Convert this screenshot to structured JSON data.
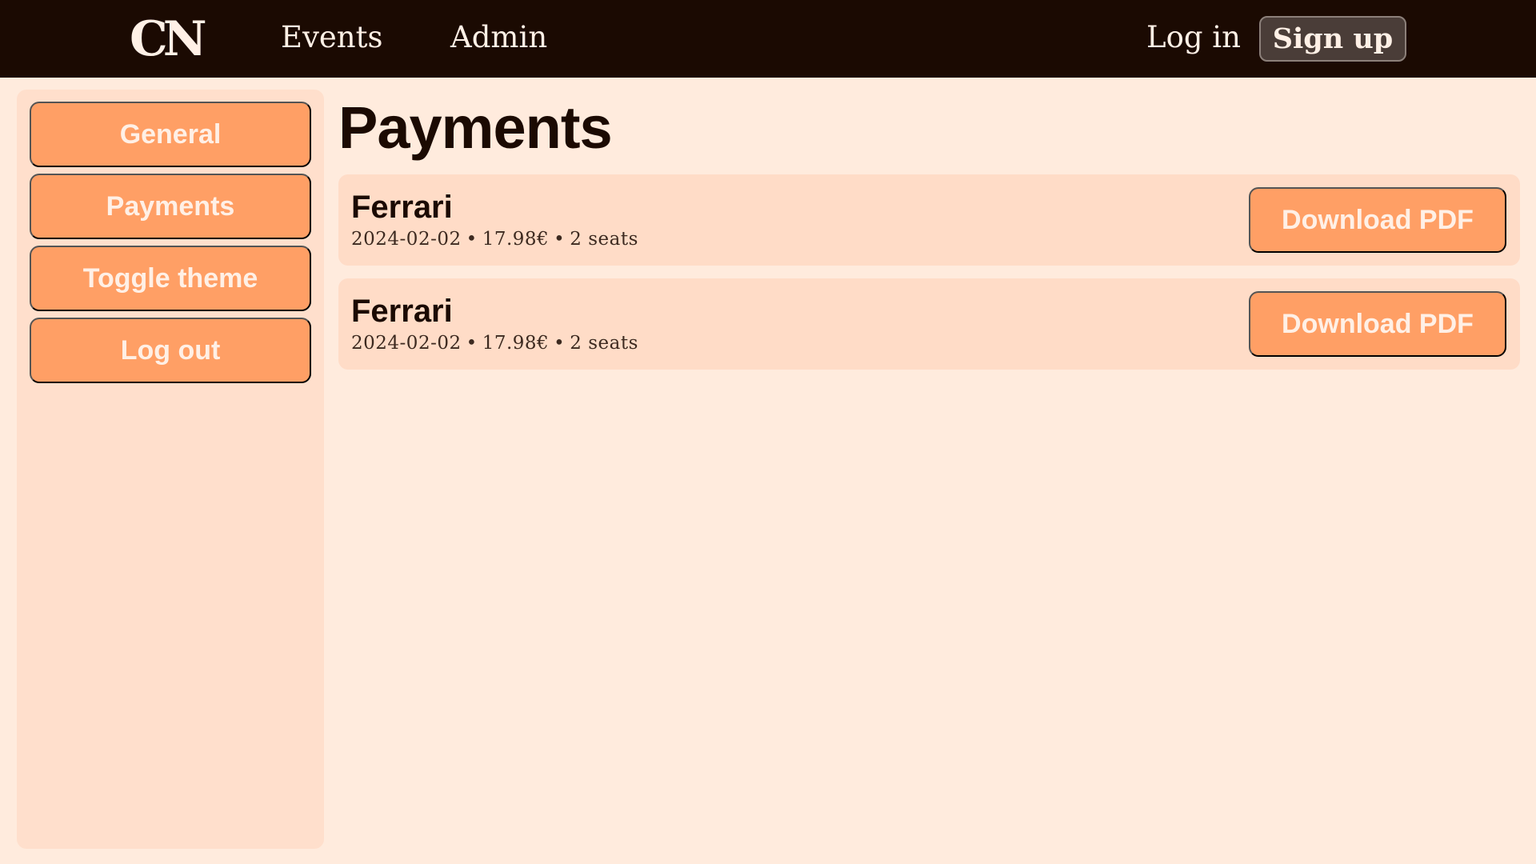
{
  "header": {
    "logo": "CN",
    "nav": {
      "events": "Events",
      "admin": "Admin"
    },
    "login": "Log in",
    "signup": "Sign up"
  },
  "sidebar": {
    "items": [
      {
        "label": "General"
      },
      {
        "label": "Payments"
      },
      {
        "label": "Toggle theme"
      },
      {
        "label": "Log out"
      }
    ]
  },
  "main": {
    "title": "Payments",
    "payments": [
      {
        "event": "Ferrari",
        "date": "2024-02-02",
        "amount": "17.98€",
        "seats": "2 seats",
        "action": "Download PDF"
      },
      {
        "event": "Ferrari",
        "date": "2024-02-02",
        "amount": "17.98€",
        "seats": "2 seats",
        "action": "Download PDF"
      }
    ],
    "separator": "•"
  },
  "colors": {
    "topbar": "#1b0a02",
    "background": "#ffebdd",
    "sidebar": "#ffdfcc",
    "accent": "#ff9f65",
    "card": "#ffdcc7",
    "signup_button": "#4a3d38"
  }
}
